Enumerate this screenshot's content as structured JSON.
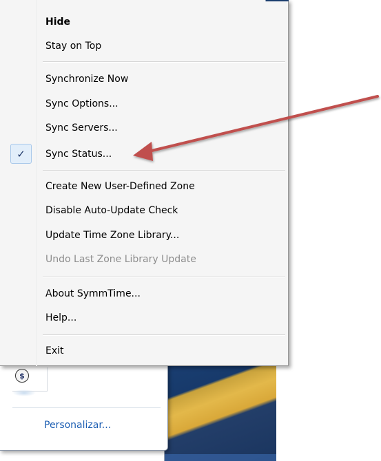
{
  "menu": {
    "items": [
      {
        "label": "Hide",
        "bold": true
      },
      {
        "label": "Stay on Top"
      },
      {
        "label": "Synchronize Now"
      },
      {
        "label": "Sync Options..."
      },
      {
        "label": "Sync Servers..."
      },
      {
        "label": "Sync Status...",
        "checked": true,
        "check_glyph": "✓"
      },
      {
        "label": "Create New User-Defined Zone"
      },
      {
        "label": "Disable Auto-Update Check"
      },
      {
        "label": "Update Time Zone Library..."
      },
      {
        "label": "Undo Last Zone Library Update",
        "disabled": true
      },
      {
        "label": "About SymmTime..."
      },
      {
        "label": "Help..."
      },
      {
        "label": "Exit"
      }
    ]
  },
  "tray_panel": {
    "icon": "symmtime-tray-icon",
    "icon_glyph": "$",
    "link_label": "Personalizar..."
  },
  "annotation": {
    "arrow_color": "#c0504d",
    "points_to": "Sync Status..."
  },
  "colors": {
    "menu_background": "#f5f5f5",
    "checked_highlight": "#e2eefa",
    "disabled_text": "#8d8d8d",
    "link_text": "#1e5fb3"
  }
}
